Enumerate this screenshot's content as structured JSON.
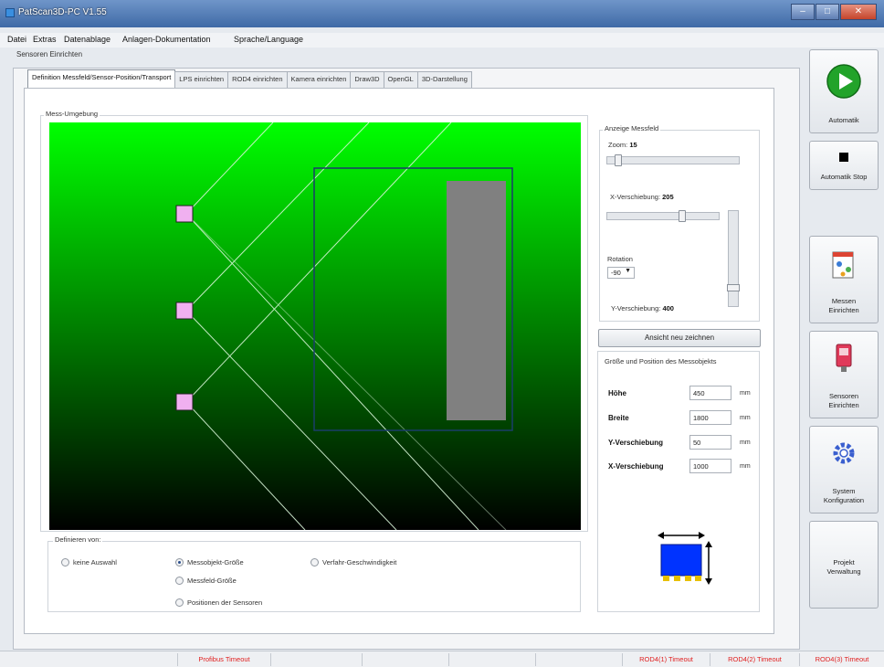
{
  "window": {
    "title": "PatScan3D-PC V1.55",
    "controls": [
      "–",
      "□",
      "✕"
    ]
  },
  "menu": [
    "Datei",
    "Extras",
    "Datenablage",
    "Anlagen-Dokumentation",
    "Sprache/Language"
  ],
  "subcaption": "Sensoren Einrichten",
  "tabs": [
    "Definition Messfeld/Sensor-Position/Transport",
    "LPS einrichten",
    "ROD4 einrichten",
    "Kamera einrichten",
    "Draw3D",
    "OpenGL",
    "3D-Darstellung"
  ],
  "mess_umgebung": {
    "label": "Mess-Umgebung"
  },
  "anzeige": {
    "label": "Anzeige Messfeld",
    "zoom_label": "Zoom:",
    "zoom_value": "15",
    "x_label": "X-Verschiebung:",
    "x_value": "205",
    "rotation_label": "Rotation",
    "rotation_value": "-90",
    "y_label": "Y-Verschiebung:",
    "y_value": "400"
  },
  "redraw_button": "Ansicht neu zeichnen",
  "object": {
    "label": "Größe und Position des Messobjekts",
    "fields": [
      {
        "label": "Höhe",
        "value": "450",
        "unit": "mm"
      },
      {
        "label": "Breite",
        "value": "1800",
        "unit": "mm"
      },
      {
        "label": "Y-Verschiebung",
        "value": "50",
        "unit": "mm"
      },
      {
        "label": "X-Verschiebung",
        "value": "1000",
        "unit": "mm"
      }
    ]
  },
  "definieren": {
    "label": "Definieren von:",
    "options": [
      "keine Auswahl",
      "Messobjekt-Größe",
      "Verfahr-Geschwindigkeit",
      "Messfeld-Größe",
      "Positionen der Sensoren"
    ],
    "selected": "Messobjekt-Größe"
  },
  "side_buttons": {
    "automatik": "Automatik",
    "automatik_stop": "Automatik Stop",
    "messen": "Messen\nEinrichten",
    "sensoren": "Sensoren\nEinrichten",
    "system": "System\nKonfiguration",
    "projekt": "Projekt\nVerwaltung"
  },
  "status": [
    "Profibus Timeout",
    "ROD4(1) Timeout",
    "ROD4(2) Timeout",
    "ROD4(3) Timeout"
  ],
  "colors": {
    "scene_top": "#00ff00",
    "scene_bottom": "#000000",
    "sensor": "#f0b0f0",
    "object": "#808080",
    "field_frame": "#1a3d6a",
    "status_error": "#e02020"
  }
}
